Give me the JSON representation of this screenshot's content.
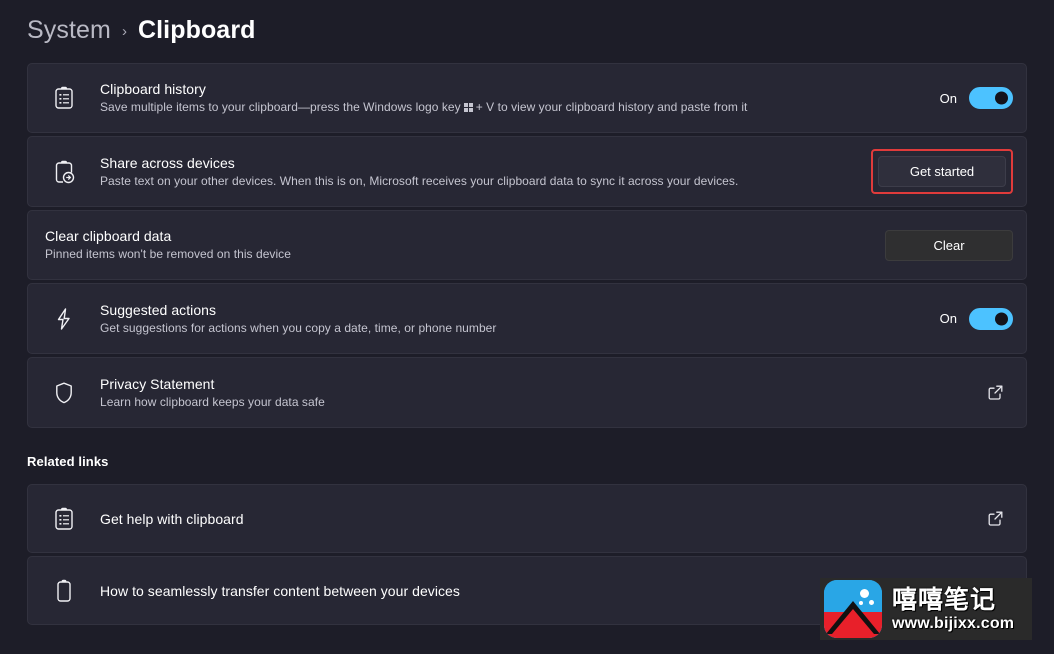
{
  "breadcrumb": {
    "parent": "System",
    "separator": "›",
    "current": "Clipboard"
  },
  "colors": {
    "page_background": "#1d1d28",
    "card_background": "#272734",
    "toggle_on": "#4cc2ff",
    "highlight_border": "#e03b3b"
  },
  "settings": [
    {
      "icon": "clipboard-list-icon",
      "title": "Clipboard history",
      "desc_before": "Save multiple items to your clipboard—press the Windows logo key",
      "desc_after": "+ V to view your clipboard history and paste from it",
      "control": "toggle",
      "toggle_label": "On",
      "toggle_state": "on"
    },
    {
      "icon": "clipboard-sync-icon",
      "title": "Share across devices",
      "desc": "Paste text on your other devices. When this is on, Microsoft receives your clipboard data to sync it across your devices.",
      "control": "button-highlighted",
      "button_label": "Get started"
    },
    {
      "icon": "none",
      "title": "Clear clipboard data",
      "desc": "Pinned items won't be removed on this device",
      "control": "button",
      "button_label": "Clear"
    },
    {
      "icon": "lightning-bolt-icon",
      "title": "Suggested actions",
      "desc": "Get suggestions for actions when you copy a date, time, or phone number",
      "control": "toggle",
      "toggle_label": "On",
      "toggle_state": "on"
    },
    {
      "icon": "shield-icon",
      "title": "Privacy Statement",
      "desc": "Learn how clipboard keeps your data safe",
      "control": "external-link"
    }
  ],
  "related": {
    "heading": "Related links",
    "items": [
      {
        "icon": "clipboard-list-icon",
        "title": "Get help with clipboard",
        "control": "external-link"
      },
      {
        "icon": "clipboard-icon",
        "title": "How to seamlessly transfer content between your devices",
        "control": "none"
      }
    ]
  },
  "watermark": {
    "name": "嘻嘻笔记",
    "url": "www.bijixx.com"
  }
}
